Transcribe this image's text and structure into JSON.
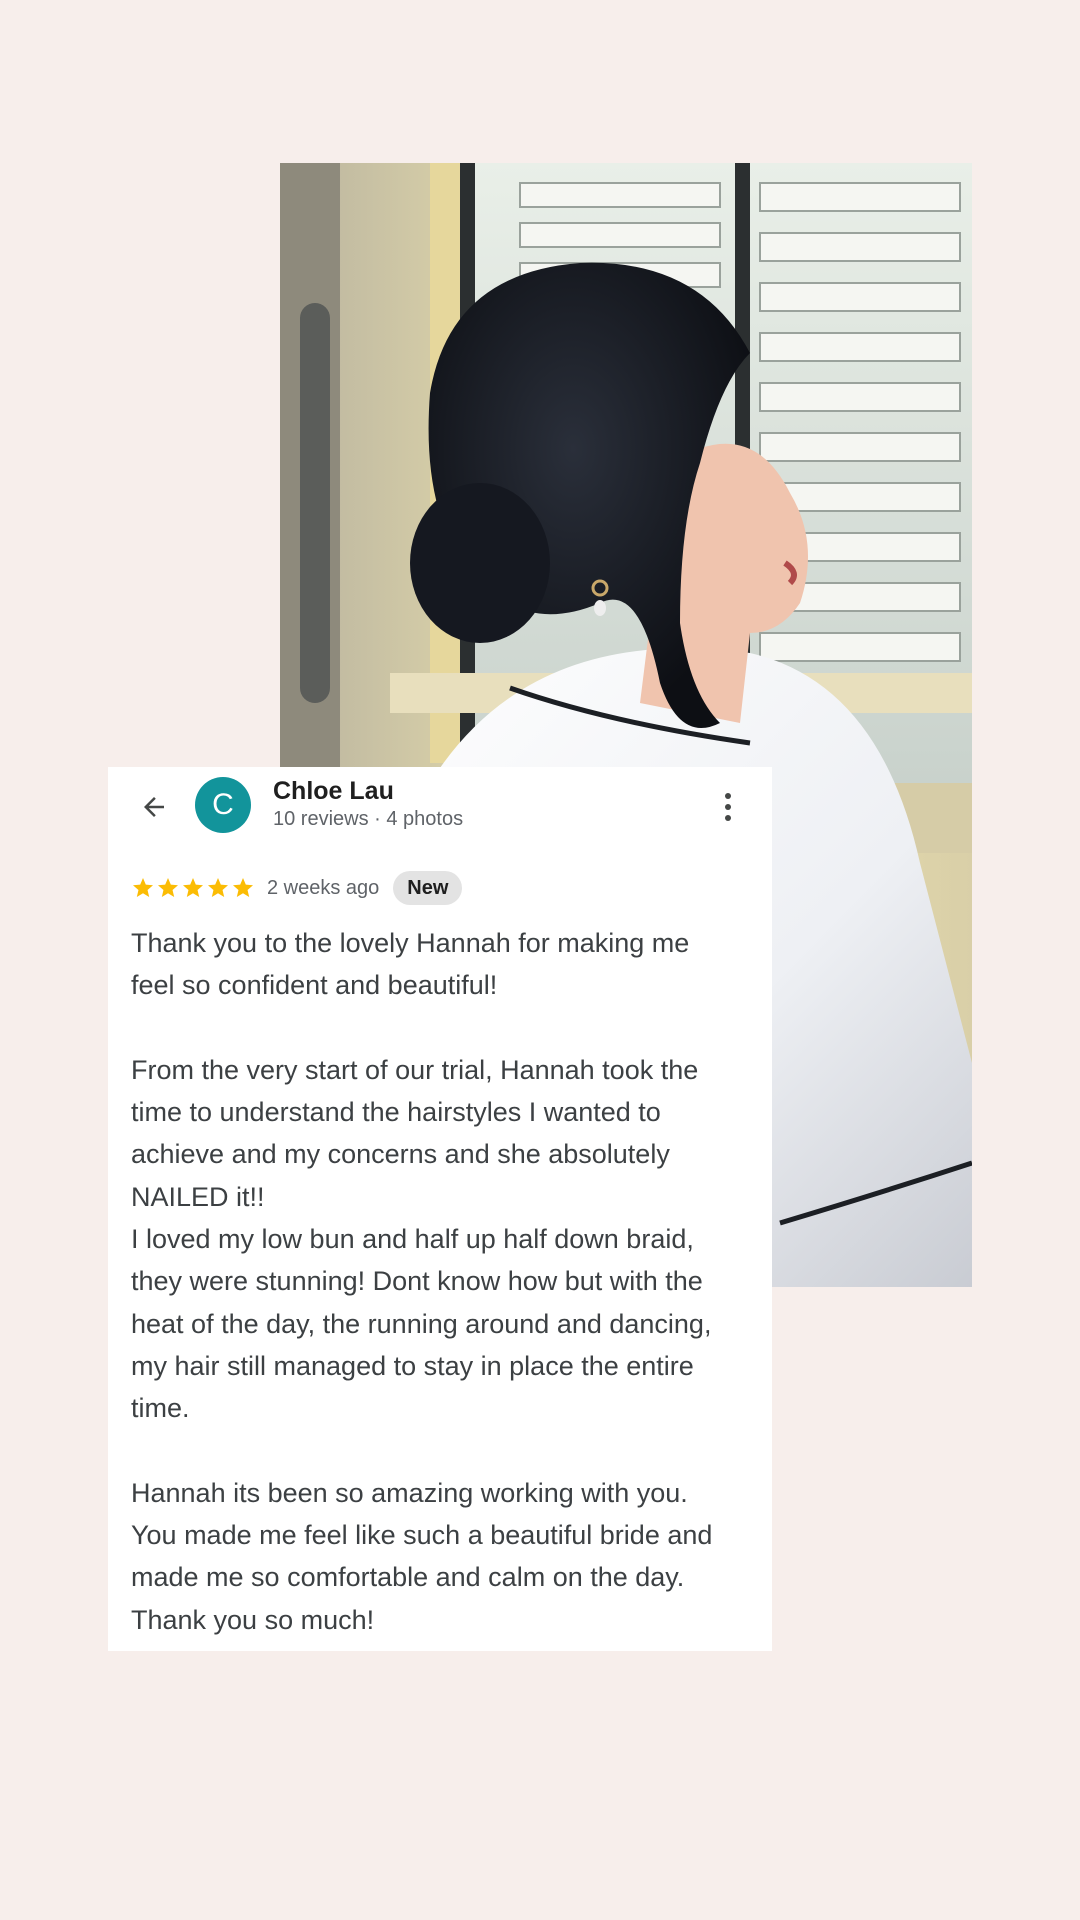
{
  "colors": {
    "page_background": "#f7eeeb",
    "avatar": "#12949b",
    "star": "#fbbc04",
    "badge": "#e3e3e3"
  },
  "photo": {
    "icon": "photo-bride-hair-updo"
  },
  "review": {
    "back_icon": "arrow-back-icon",
    "more_icon": "more-vert-icon",
    "avatar_letter": "C",
    "reviewer_name": "Chloe Lau",
    "reviewer_meta": "10 reviews · 4 photos",
    "rating": 5,
    "max_rating": 5,
    "time_ago": "2 weeks ago",
    "badge": "New",
    "paragraphs": [
      [
        "Thank you to the lovely Hannah for making me",
        "feel so confident and beautiful!"
      ],
      [
        "From the very start of our trial, Hannah took the",
        "time to understand the hairstyles I wanted to",
        "achieve and my concerns and she absolutely",
        "NAILED it!!",
        "I loved my low bun and half up half down braid,",
        "they were stunning! Dont know how but with the",
        "heat of the day, the running around and dancing,",
        "my hair still managed to stay in place the entire",
        "time."
      ],
      [
        "Hannah its been so amazing working with you.",
        "You made me feel like such a beautiful bride and",
        "made me so comfortable and calm on the day.",
        "Thank you so much!"
      ]
    ]
  }
}
